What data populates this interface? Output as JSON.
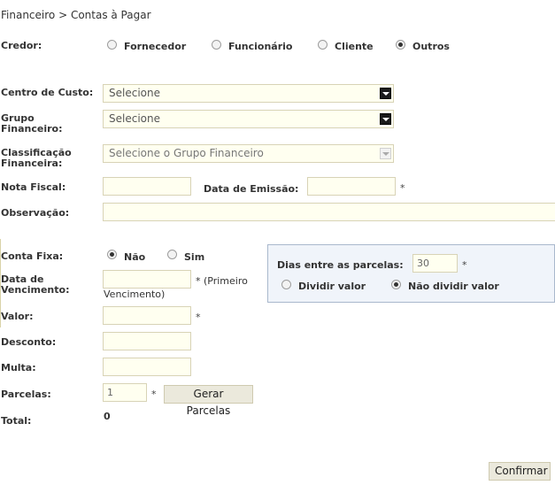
{
  "breadcrumb": "Financeiro > Contas à Pagar",
  "credor": {
    "label": "Credor:",
    "options": [
      {
        "label": "Fornecedor",
        "checked": false
      },
      {
        "label": "Funcionário",
        "checked": false
      },
      {
        "label": "Cliente",
        "checked": false
      },
      {
        "label": "Outros",
        "checked": true
      }
    ]
  },
  "centro_custo": {
    "label": "Centro de Custo:",
    "value": "Selecione"
  },
  "grupo_financeiro": {
    "label_line1": "Grupo",
    "label_line2": "Financeiro:",
    "value": "Selecione"
  },
  "classificacao": {
    "label_line1": "Classificação",
    "label_line2": "Financeira:",
    "value": "Selecione o Grupo Financeiro"
  },
  "nota_fiscal": {
    "label": "Nota Fiscal:",
    "value": ""
  },
  "data_emissao": {
    "label": "Data de Emissão:",
    "value": "",
    "required": "*"
  },
  "observacao": {
    "label": "Observação:",
    "value": ""
  },
  "conta_fixa": {
    "label": "Conta Fixa:",
    "options": [
      {
        "label": "Não",
        "checked": true
      },
      {
        "label": "Sim",
        "checked": false
      }
    ]
  },
  "vencimento": {
    "label_line1": "Data de",
    "label_line2": "Vencimento:",
    "value": "",
    "note_line1": "* (Primeiro",
    "note_line2": "Vencimento)"
  },
  "valor": {
    "label": "Valor:",
    "value": "",
    "required": "*"
  },
  "desconto": {
    "label": "Desconto:",
    "value": ""
  },
  "multa": {
    "label": "Multa:",
    "value": ""
  },
  "parcelas": {
    "label": "Parcelas:",
    "value": "1",
    "required": "*",
    "button": "Gerar Parcelas"
  },
  "total": {
    "label": "Total:",
    "value": "0"
  },
  "panel": {
    "dias_label": "Dias entre as parcelas:",
    "dias_value": "30",
    "required": "*",
    "options": [
      {
        "label": "Dividir valor",
        "checked": false
      },
      {
        "label": "Não dividir valor",
        "checked": true
      }
    ]
  },
  "confirm_button": "Confirmar"
}
